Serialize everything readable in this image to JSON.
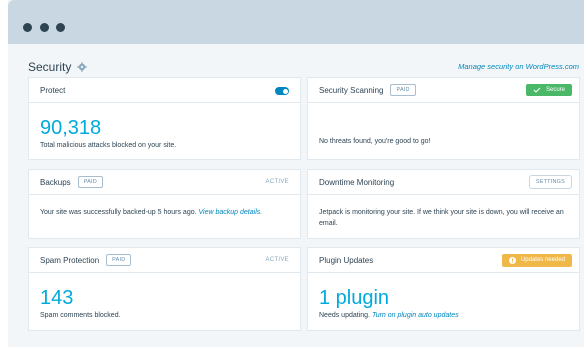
{
  "section": {
    "title": "Security",
    "manage_link": "Manage security on WordPress.com"
  },
  "cards": {
    "protect": {
      "title": "Protect",
      "count": "90,318",
      "description": "Total malicious attacks blocked on your site."
    },
    "scanning": {
      "title": "Security Scanning",
      "badge": "PAID",
      "status": "Secure",
      "description": "No threats found, you're good to go!"
    },
    "backups": {
      "title": "Backups",
      "badge": "PAID",
      "status": "ACTIVE",
      "description": "Your site was successfully backed-up 5 hours ago.",
      "link": "View backup details."
    },
    "downtime": {
      "title": "Downtime Monitoring",
      "button": "SETTINGS",
      "description": "Jetpack is monitoring your site. If we think your site is down, you will receive an email."
    },
    "spam": {
      "title": "Spam Protection",
      "badge": "PAID",
      "status": "ACTIVE",
      "count": "143",
      "description": "Spam comments blocked."
    },
    "plugins": {
      "title": "Plugin Updates",
      "status": "Updates needed",
      "count": "1 plugin",
      "description": "Needs updating.",
      "link": "Turn on plugin auto updates"
    }
  },
  "colors": {
    "accent": "#00aadc",
    "link": "#0087be",
    "success": "#4ab866",
    "warning": "#f0b849"
  },
  "icons": [
    "gear-icon",
    "checkmark-icon",
    "alert-icon",
    "toggle-switch"
  ]
}
